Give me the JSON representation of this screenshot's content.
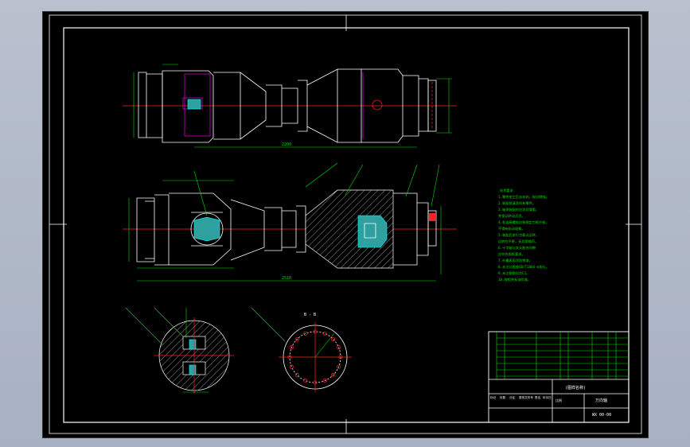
{
  "drawing": {
    "dims": {
      "top_len": "2200",
      "mid_len": "2510"
    },
    "section_label": "B - B",
    "notes": [
      "技术要求",
      "1.零件加工后去毛刺，锐边倒钝。",
      "2.装配前清洗所有零件。",
      "3.轴承装配时应涂润滑脂，",
      "并保证转动灵活。",
      "4.各连接螺栓应按规定力矩拧紧，",
      "不得有松动现象。",
      "5.装配后进行空载试运转，",
      "运转应平稳，无异常噪声。",
      "6.十字轴与叉头配合间隙",
      "应符合图纸要求。",
      "7.外露表面涂防锈漆。",
      "8.未注公差按GB/T1804-m执行。",
      "9.未注倒角均为C1。",
      "10.按相关标准验收。"
    ],
    "title_block": {
      "drawing_title": "(图样名称)",
      "part_name": "万向轴",
      "drawing_no": "WX 00-00",
      "scale_label": "比例",
      "rows": [
        "标记",
        "处数",
        "分区",
        "更改文件号",
        "签名",
        "年月日"
      ]
    }
  }
}
